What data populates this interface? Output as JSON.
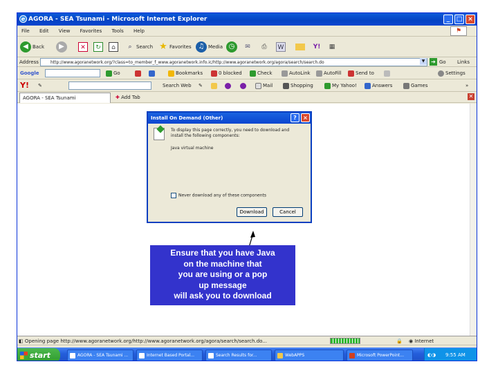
{
  "window": {
    "title": "AGORA - SEA Tsunami - Microsoft Internet Explorer",
    "minimize": "_",
    "maximize": "□",
    "close": "×"
  },
  "menu": [
    "File",
    "Edit",
    "View",
    "Favorites",
    "Tools",
    "Help"
  ],
  "toolbar": {
    "back": "Back",
    "search": "Search",
    "favorites": "Favorites",
    "media": "Media"
  },
  "address": {
    "label": "Address",
    "url": "http://www.agoranetwork.org/?class=to_member_f_www.agoranetwork.info.ic/http://www.agoranetwork.org/agora/search/search.do",
    "go": "Go",
    "links": "Links"
  },
  "googlebar": {
    "brand": "Google",
    "go": "Go",
    "bookmarks": "Bookmarks",
    "blocked": "0 blocked",
    "check": "Check",
    "autolink": "AutoLink",
    "autofill": "AutoFill",
    "sendto": "Send to",
    "settings": "Settings"
  },
  "yahoobar": {
    "brand": "Y!",
    "search_web": "Search Web",
    "mail": "Mail",
    "shopping": "Shopping",
    "my_yahoo": "My Yahoo!",
    "answers": "Answers",
    "games": "Games"
  },
  "tabs": {
    "active": "AGORA - SEA Tsunami",
    "add": "Add Tab"
  },
  "dialog": {
    "title": "Install On Demand (Other)",
    "help": "?",
    "close": "×",
    "message": "To display this page correctly, you need to download and install the following components:",
    "component": "Java virtual machine",
    "checkbox_label": "Never download any of these components",
    "download": "Download",
    "cancel": "Cancel"
  },
  "callout": {
    "line1": "Ensure that you have Java",
    "line2": "on the machine that",
    "line3": "you  are using or a pop",
    "line4": "up message",
    "line5": "will ask  you to download"
  },
  "status": {
    "text": "Opening page http://www.agoranetwork.org/http://www.agoranetwork.org/agora/search/search.do...",
    "zone": "Internet"
  },
  "taskbar": {
    "start": "start",
    "tasks": [
      "AGORA - SEA Tsunami ...",
      "Internet Based Portal...",
      "Search Results for...",
      "WebAPPS",
      "Microsoft PowerPoint..."
    ],
    "clock": "9:55 AM"
  },
  "colors": {
    "titlebar": "#0a46d0",
    "callout": "#3333cc",
    "start": "#2e9a2e"
  }
}
